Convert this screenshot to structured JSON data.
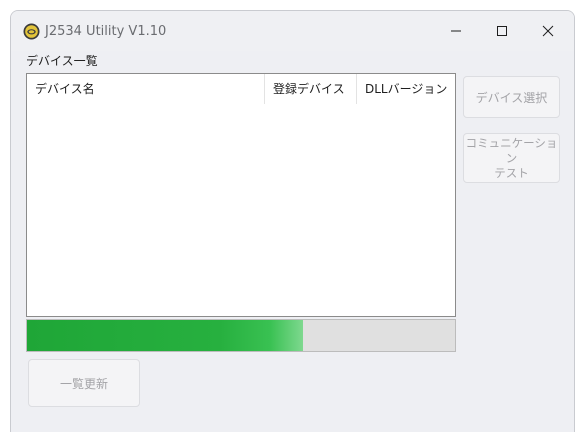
{
  "window": {
    "title": "J2534 Utility V1.10",
    "controls": {
      "minimize_icon": "minimize-icon",
      "maximize_icon": "maximize-icon",
      "close_icon": "close-icon"
    }
  },
  "device_list": {
    "caption": "デバイス一覧",
    "columns": [
      "デバイス名",
      "登録デバイス",
      "DLLバージョン"
    ],
    "rows": []
  },
  "buttons": {
    "select_device": "デバイス選択",
    "comm_test_line1": "コミュニケーション",
    "comm_test_line2": "テスト",
    "refresh": "一覧更新"
  },
  "progress": {
    "value": 0.645,
    "color": "#27b03f"
  },
  "colors": {
    "window_bg": "#eeeff3",
    "disabled_text": "#a3a3a7",
    "app_icon": "#d8b72a"
  }
}
